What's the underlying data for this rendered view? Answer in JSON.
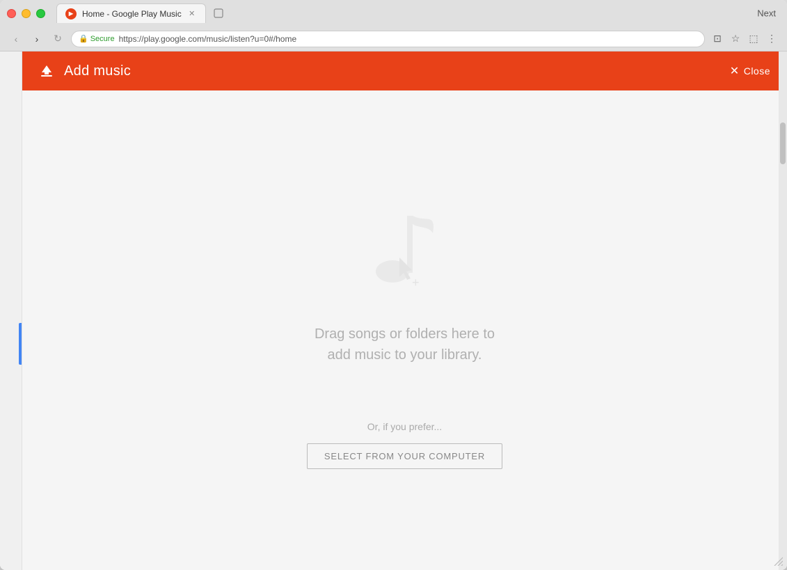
{
  "window": {
    "title": "Home - Google Play Music",
    "next_button": "Next"
  },
  "browser": {
    "url": "https://play.google.com/music/listen?u=0#/home",
    "secure_label": "Secure",
    "tab_title": "Home - Google Play Music"
  },
  "header": {
    "title": "Add music",
    "close_label": "Close",
    "upload_icon": "⬆"
  },
  "drop_zone": {
    "drag_text_line1": "Drag songs or folders here to",
    "drag_text_line2": "add music to your library.",
    "or_prefer_text": "Or, if you prefer...",
    "select_button_label": "SELECT FROM YOUR COMPUTER"
  }
}
